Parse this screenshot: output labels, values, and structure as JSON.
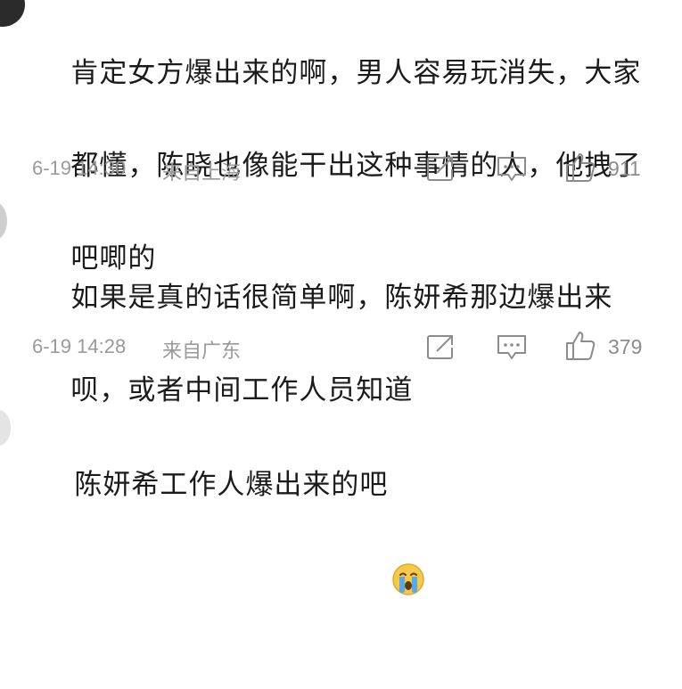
{
  "comments": [
    {
      "text_lines": [
        "肯定女方爆出来的啊，男人容易玩消失，大家",
        "都懂，陈晓也像能干出这种事情的人，他拽了",
        "吧唧的"
      ],
      "date": "6-19 14:30",
      "location": "来自上海",
      "likes": "911",
      "icons": [
        "share-icon",
        "comment-icon",
        "thumbs-up-icon"
      ]
    },
    {
      "text_lines": [
        "如果是真的话很简单啊，陈妍希那边爆出来",
        "呗，或者中间工作人员知道"
      ],
      "date": "6-19 14:28",
      "location": "来自广东",
      "likes": "379",
      "icons": [
        "share-icon",
        "comment-icon",
        "thumbs-up-icon"
      ]
    },
    {
      "text_lines": [
        "陈妍希工作人爆出来的吧"
      ],
      "emoji": "crying-face-emoji"
    }
  ],
  "colors": {
    "text": "#1b1b1b",
    "meta": "#9a9a9a",
    "icon": "#8c8c8c",
    "emoji_face": "#f7c948",
    "emoji_tear": "#5aa9e6"
  }
}
